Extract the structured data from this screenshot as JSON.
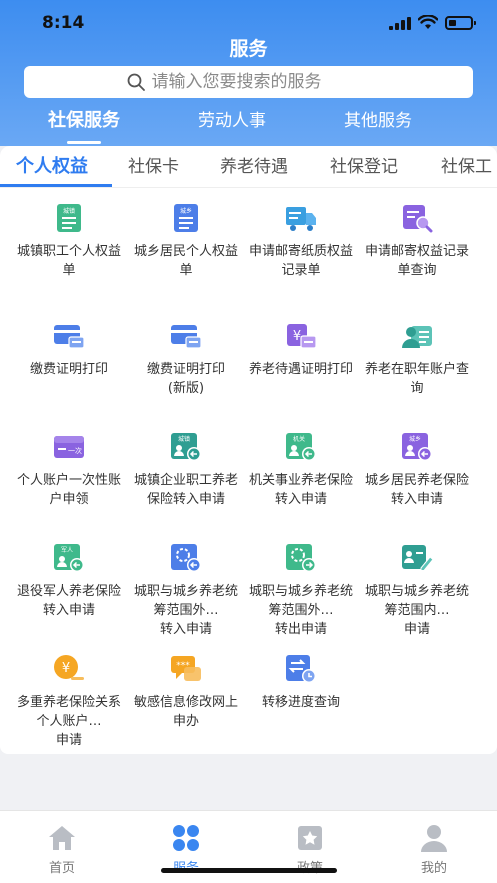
{
  "status": {
    "time": "8:14"
  },
  "header": {
    "title": "服务"
  },
  "search": {
    "placeholder": "请输入您要搜索的服务"
  },
  "top_tabs": [
    {
      "label": "社保服务",
      "active": true
    },
    {
      "label": "劳动人事",
      "active": false
    },
    {
      "label": "其他服务",
      "active": false
    }
  ],
  "sub_tabs": [
    {
      "label": "个人权益",
      "active": true
    },
    {
      "label": "社保卡",
      "active": false
    },
    {
      "label": "养老待遇",
      "active": false
    },
    {
      "label": "社保登记",
      "active": false
    },
    {
      "label": "社保工",
      "active": false
    }
  ],
  "services": [
    {
      "label": "城镇职工个人权益单",
      "icon": "document-icon",
      "badge": "城镇"
    },
    {
      "label": "城乡居民个人权益单",
      "icon": "document-icon",
      "badge": "城乡"
    },
    {
      "label": "申请邮寄纸质权益记录单",
      "icon": "mail-truck-icon",
      "badge": ""
    },
    {
      "label": "申请邮寄权益记录单查询",
      "icon": "mail-search-icon",
      "badge": ""
    },
    {
      "label": "缴费证明打印",
      "icon": "card-print-icon",
      "badge": ""
    },
    {
      "label": "缴费证明打印\n(新版)",
      "icon": "card-print-icon",
      "badge": ""
    },
    {
      "label": "养老待遇证明打印",
      "icon": "yuan-print-icon",
      "badge": "¥"
    },
    {
      "label": "养老在职年账户查询",
      "icon": "person-card-icon",
      "badge": ""
    },
    {
      "label": "个人账户一次性账户申领",
      "icon": "account-icon",
      "badge": "一次"
    },
    {
      "label": "城镇企业职工养老保险转入申请",
      "icon": "transfer-in-icon",
      "badge": "城镇"
    },
    {
      "label": "机关事业养老保险转入申请",
      "icon": "transfer-in-icon",
      "badge": "机关"
    },
    {
      "label": "城乡居民养老保险转入申请",
      "icon": "transfer-in-icon",
      "badge": "城乡"
    },
    {
      "label": "退役军人养老保险转入申请",
      "icon": "transfer-in-icon",
      "badge": "军人"
    },
    {
      "label": "城职与城乡养老统筹范围外…\n转入申请",
      "icon": "transfer-in-icon",
      "badge": ""
    },
    {
      "label": "城职与城乡养老统筹范围外…\n转出申请",
      "icon": "transfer-out-icon",
      "badge": ""
    },
    {
      "label": "城职与城乡养老统筹范围内…\n申请",
      "icon": "edit-card-icon",
      "badge": ""
    },
    {
      "label": "多重养老保险关系个人账户…\n申请",
      "icon": "yuan-coin-icon",
      "badge": "¥"
    },
    {
      "label": "敏感信息修改网上申办",
      "icon": "chat-bubble-icon",
      "badge": "***"
    },
    {
      "label": "转移进度查询",
      "icon": "progress-query-icon",
      "badge": ""
    }
  ],
  "bottom_nav": [
    {
      "label": "首页",
      "icon": "home-icon",
      "active": false
    },
    {
      "label": "服务",
      "icon": "grid-icon",
      "active": true
    },
    {
      "label": "政策",
      "icon": "policy-icon",
      "active": false
    },
    {
      "label": "我的",
      "icon": "user-icon",
      "active": false
    }
  ],
  "colors": {
    "header_top": "#3d8df0",
    "header_bottom": "#6aa8f4",
    "accent": "#2f7cf0",
    "green": "#3fb98b",
    "blue": "#4d7ee8",
    "purple": "#8a63e0",
    "orange": "#f5a623",
    "teal": "#3fb5a8"
  }
}
